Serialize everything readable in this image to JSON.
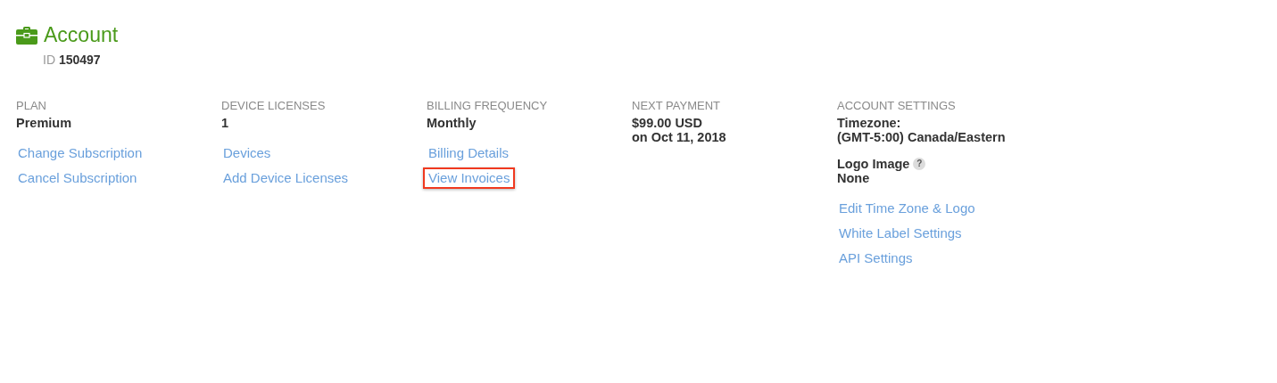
{
  "header": {
    "title": "Account",
    "id_label": "ID",
    "id_value": "150497"
  },
  "columns": [
    {
      "heading": "PLAN",
      "entries": [
        {
          "lines": [
            "Premium"
          ]
        }
      ],
      "links": [
        {
          "label": "Change Subscription",
          "highlighted": false
        },
        {
          "label": "Cancel Subscription",
          "highlighted": false
        }
      ]
    },
    {
      "heading": "DEVICE LICENSES",
      "entries": [
        {
          "lines": [
            "1"
          ]
        }
      ],
      "links": [
        {
          "label": "Devices",
          "highlighted": false
        },
        {
          "label": "Add Device Licenses",
          "highlighted": false
        }
      ]
    },
    {
      "heading": "BILLING FREQUENCY",
      "entries": [
        {
          "lines": [
            "Monthly"
          ]
        }
      ],
      "links": [
        {
          "label": "Billing Details",
          "highlighted": false
        },
        {
          "label": "View Invoices",
          "highlighted": true
        }
      ]
    },
    {
      "heading": "NEXT PAYMENT",
      "entries": [
        {
          "lines": [
            "$99.00 USD",
            "on Oct 11, 2018"
          ]
        }
      ]
    },
    {
      "heading": "ACCOUNT SETTINGS",
      "entries": [
        {
          "lines": [
            "Timezone:",
            "(GMT-5:00) Canada/Eastern"
          ]
        },
        {
          "lines": [
            "Logo Image",
            "None"
          ],
          "help": "?"
        }
      ],
      "links": [
        {
          "label": "Edit Time Zone & Logo",
          "highlighted": false
        },
        {
          "label": "White Label Settings",
          "highlighted": false
        },
        {
          "label": "API Settings",
          "highlighted": false
        }
      ]
    }
  ]
}
